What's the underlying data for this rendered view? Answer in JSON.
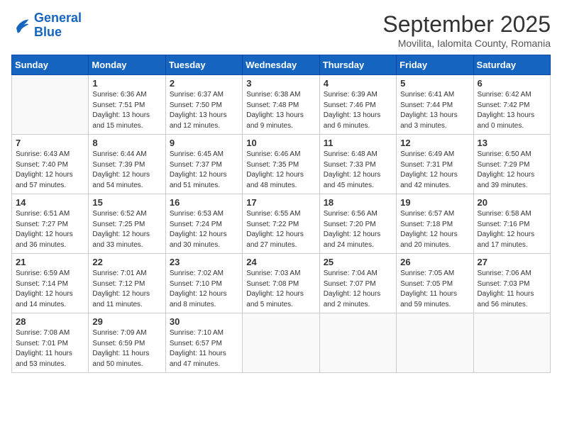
{
  "header": {
    "logo_line1": "General",
    "logo_line2": "Blue",
    "month": "September 2025",
    "location": "Movilita, Ialomita County, Romania"
  },
  "weekdays": [
    "Sunday",
    "Monday",
    "Tuesday",
    "Wednesday",
    "Thursday",
    "Friday",
    "Saturday"
  ],
  "weeks": [
    [
      {
        "day": "",
        "info": ""
      },
      {
        "day": "1",
        "info": "Sunrise: 6:36 AM\nSunset: 7:51 PM\nDaylight: 13 hours\nand 15 minutes."
      },
      {
        "day": "2",
        "info": "Sunrise: 6:37 AM\nSunset: 7:50 PM\nDaylight: 13 hours\nand 12 minutes."
      },
      {
        "day": "3",
        "info": "Sunrise: 6:38 AM\nSunset: 7:48 PM\nDaylight: 13 hours\nand 9 minutes."
      },
      {
        "day": "4",
        "info": "Sunrise: 6:39 AM\nSunset: 7:46 PM\nDaylight: 13 hours\nand 6 minutes."
      },
      {
        "day": "5",
        "info": "Sunrise: 6:41 AM\nSunset: 7:44 PM\nDaylight: 13 hours\nand 3 minutes."
      },
      {
        "day": "6",
        "info": "Sunrise: 6:42 AM\nSunset: 7:42 PM\nDaylight: 13 hours\nand 0 minutes."
      }
    ],
    [
      {
        "day": "7",
        "info": "Sunrise: 6:43 AM\nSunset: 7:40 PM\nDaylight: 12 hours\nand 57 minutes."
      },
      {
        "day": "8",
        "info": "Sunrise: 6:44 AM\nSunset: 7:39 PM\nDaylight: 12 hours\nand 54 minutes."
      },
      {
        "day": "9",
        "info": "Sunrise: 6:45 AM\nSunset: 7:37 PM\nDaylight: 12 hours\nand 51 minutes."
      },
      {
        "day": "10",
        "info": "Sunrise: 6:46 AM\nSunset: 7:35 PM\nDaylight: 12 hours\nand 48 minutes."
      },
      {
        "day": "11",
        "info": "Sunrise: 6:48 AM\nSunset: 7:33 PM\nDaylight: 12 hours\nand 45 minutes."
      },
      {
        "day": "12",
        "info": "Sunrise: 6:49 AM\nSunset: 7:31 PM\nDaylight: 12 hours\nand 42 minutes."
      },
      {
        "day": "13",
        "info": "Sunrise: 6:50 AM\nSunset: 7:29 PM\nDaylight: 12 hours\nand 39 minutes."
      }
    ],
    [
      {
        "day": "14",
        "info": "Sunrise: 6:51 AM\nSunset: 7:27 PM\nDaylight: 12 hours\nand 36 minutes."
      },
      {
        "day": "15",
        "info": "Sunrise: 6:52 AM\nSunset: 7:25 PM\nDaylight: 12 hours\nand 33 minutes."
      },
      {
        "day": "16",
        "info": "Sunrise: 6:53 AM\nSunset: 7:24 PM\nDaylight: 12 hours\nand 30 minutes."
      },
      {
        "day": "17",
        "info": "Sunrise: 6:55 AM\nSunset: 7:22 PM\nDaylight: 12 hours\nand 27 minutes."
      },
      {
        "day": "18",
        "info": "Sunrise: 6:56 AM\nSunset: 7:20 PM\nDaylight: 12 hours\nand 24 minutes."
      },
      {
        "day": "19",
        "info": "Sunrise: 6:57 AM\nSunset: 7:18 PM\nDaylight: 12 hours\nand 20 minutes."
      },
      {
        "day": "20",
        "info": "Sunrise: 6:58 AM\nSunset: 7:16 PM\nDaylight: 12 hours\nand 17 minutes."
      }
    ],
    [
      {
        "day": "21",
        "info": "Sunrise: 6:59 AM\nSunset: 7:14 PM\nDaylight: 12 hours\nand 14 minutes."
      },
      {
        "day": "22",
        "info": "Sunrise: 7:01 AM\nSunset: 7:12 PM\nDaylight: 12 hours\nand 11 minutes."
      },
      {
        "day": "23",
        "info": "Sunrise: 7:02 AM\nSunset: 7:10 PM\nDaylight: 12 hours\nand 8 minutes."
      },
      {
        "day": "24",
        "info": "Sunrise: 7:03 AM\nSunset: 7:08 PM\nDaylight: 12 hours\nand 5 minutes."
      },
      {
        "day": "25",
        "info": "Sunrise: 7:04 AM\nSunset: 7:07 PM\nDaylight: 12 hours\nand 2 minutes."
      },
      {
        "day": "26",
        "info": "Sunrise: 7:05 AM\nSunset: 7:05 PM\nDaylight: 11 hours\nand 59 minutes."
      },
      {
        "day": "27",
        "info": "Sunrise: 7:06 AM\nSunset: 7:03 PM\nDaylight: 11 hours\nand 56 minutes."
      }
    ],
    [
      {
        "day": "28",
        "info": "Sunrise: 7:08 AM\nSunset: 7:01 PM\nDaylight: 11 hours\nand 53 minutes."
      },
      {
        "day": "29",
        "info": "Sunrise: 7:09 AM\nSunset: 6:59 PM\nDaylight: 11 hours\nand 50 minutes."
      },
      {
        "day": "30",
        "info": "Sunrise: 7:10 AM\nSunset: 6:57 PM\nDaylight: 11 hours\nand 47 minutes."
      },
      {
        "day": "",
        "info": ""
      },
      {
        "day": "",
        "info": ""
      },
      {
        "day": "",
        "info": ""
      },
      {
        "day": "",
        "info": ""
      }
    ]
  ]
}
